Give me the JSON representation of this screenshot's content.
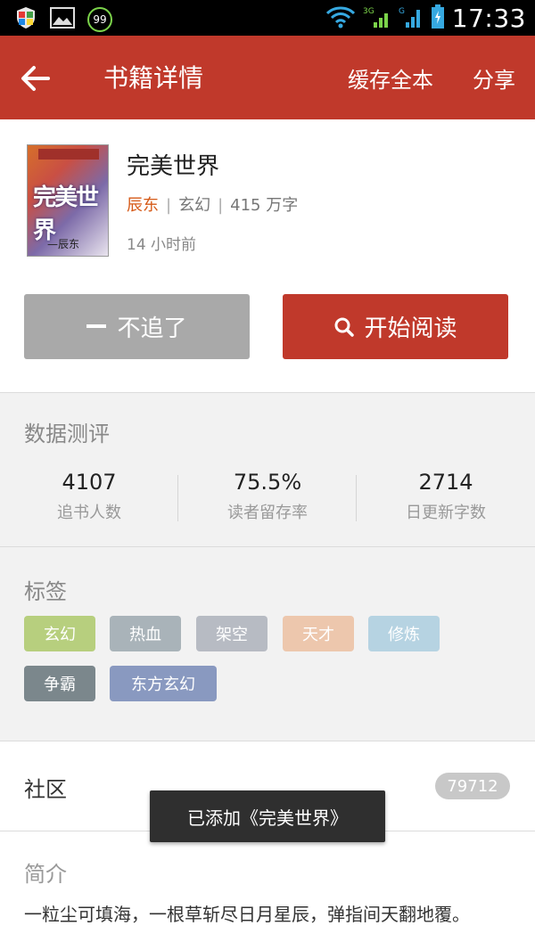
{
  "status_bar": {
    "time": "17:33",
    "badge_99": "99",
    "network_3g": "3G",
    "network_g": "G"
  },
  "app_bar": {
    "title": "书籍详情",
    "cache_all": "缓存全本",
    "share": "分享"
  },
  "book": {
    "cover_title": "完美世界",
    "cover_author": "—辰东",
    "title": "完美世界",
    "author": "辰东",
    "genre": "玄幻",
    "word_count": "415 万字",
    "updated": "14 小时前",
    "separator": "|"
  },
  "actions": {
    "unfollow_label": "不追了",
    "read_label": "开始阅读"
  },
  "data_review": {
    "title": "数据测评",
    "stats": [
      {
        "value": "4107",
        "label": "追书人数"
      },
      {
        "value": "75.5%",
        "label": "读者留存率"
      },
      {
        "value": "2714",
        "label": "日更新字数"
      }
    ]
  },
  "tags": {
    "title": "标签",
    "items": [
      {
        "label": "玄幻",
        "color": "#b7cf7e"
      },
      {
        "label": "热血",
        "color": "#a9b3b9"
      },
      {
        "label": "架空",
        "color": "#b7bbc3"
      },
      {
        "label": "天才",
        "color": "#edc7ad"
      },
      {
        "label": "修炼",
        "color": "#b6d3e2"
      },
      {
        "label": "争霸",
        "color": "#7b878c"
      },
      {
        "label": "东方玄幻",
        "color": "#8999c0"
      }
    ]
  },
  "community": {
    "label": "社区",
    "count": "79712"
  },
  "toast": {
    "message": "已添加《完美世界》"
  },
  "intro": {
    "title": "简介",
    "text": "一粒尘可填海，一根草斩尽日月星辰，弹指间天翻地覆。"
  },
  "colors": {
    "primary": "#c0392b",
    "author": "#d65a18",
    "unfollow_button": "#a9a9a9"
  }
}
